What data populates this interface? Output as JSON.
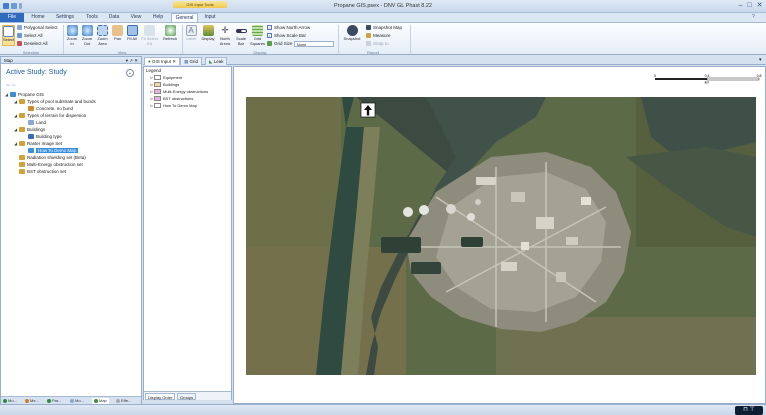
{
  "window": {
    "title": "Propane GIS.psex - DNV GL Phast 8.22",
    "context_tab_group": "GIS Input Tools",
    "minimize": "–",
    "maximize": "□",
    "close": "✕"
  },
  "tabs": [
    "File",
    "Home",
    "Settings",
    "Tools",
    "Data",
    "View",
    "Help",
    "General",
    "Input"
  ],
  "active_tab": "General",
  "ribbon": {
    "selection": {
      "label": "Selection",
      "select": "Select",
      "polygonal_select": "Polygonal Select",
      "select_all": "Select All",
      "deselect_all": "Deselect All"
    },
    "view": {
      "label": "View",
      "zoom_in": "Zoom In",
      "zoom_out": "Zoom Out",
      "zoom_area": "Zoom Area",
      "pan": "Pan",
      "fit_all": "Fit All",
      "fit_select": "Fit Select Ed",
      "refresh": "Refresh"
    },
    "display": {
      "label": "Display",
      "label_btn": "Label",
      "display_btn": "Display",
      "north_arrow": "North Arrow",
      "scale_bar": "Scale Bar",
      "grid_squares": "Grid Squares",
      "show_north_arrow": "Show North Arrow",
      "show_scale_bar": "Show Scale Bar",
      "grid_size": "Grid Size",
      "grid_size_value": "None"
    },
    "report": {
      "label": "Report",
      "snapshot": "Snapshot",
      "snapshot_map": "Snapshot Map",
      "measure": "Measure",
      "snap_to": "Snap to"
    }
  },
  "left_panel": {
    "header": "Map",
    "header_controls": "▾ ↗ ✕",
    "study": "Active Study: Study",
    "tree": [
      {
        "label": "Propane GIS",
        "level": 0,
        "toggle": "◢"
      },
      {
        "label": "Types of pool substrate and bunds",
        "level": 1,
        "toggle": "◢"
      },
      {
        "label": "Concrete, no bund",
        "level": 2,
        "toggle": ""
      },
      {
        "label": "Types of terrain for dispersion",
        "level": 1,
        "toggle": "◢"
      },
      {
        "label": "Land",
        "level": 2,
        "toggle": ""
      },
      {
        "label": "Buildings",
        "level": 1,
        "toggle": "◢"
      },
      {
        "label": "Building type",
        "level": 2,
        "toggle": ""
      },
      {
        "label": "Raster Image Set",
        "level": 1,
        "toggle": "◢"
      },
      {
        "label": "How To Demo Map",
        "level": 2,
        "toggle": "",
        "selected": true
      },
      {
        "label": "Radiation shielding set (Beta)",
        "level": 1,
        "toggle": ""
      },
      {
        "label": "Multi-Energy obstruction set",
        "level": 1,
        "toggle": ""
      },
      {
        "label": "BST obstruction set",
        "level": 1,
        "toggle": ""
      }
    ],
    "footer_tabs": [
      "Mo...",
      "Me...",
      "Par...",
      "Mo...",
      "Map",
      "Effe..."
    ]
  },
  "doc_tabs": [
    {
      "label": "GIS Input",
      "active": true
    },
    {
      "label": "Grid",
      "active": false
    },
    {
      "label": "Leak",
      "active": false
    }
  ],
  "legend": {
    "title": "Legend",
    "items": [
      "Equipment",
      "Buildings",
      "Multi-Energy obstructions",
      "BST obstructions",
      "How To Demo Map"
    ],
    "footer_tabs": [
      "Display Order",
      "Groups"
    ]
  },
  "scale_bar": {
    "ticks": [
      "0",
      "0.4",
      "0.8"
    ],
    "unit": "km"
  },
  "colors": {
    "accent": "#2e6bbd",
    "selected": "#3d8fe0",
    "study_title": "#1d5fa6"
  }
}
